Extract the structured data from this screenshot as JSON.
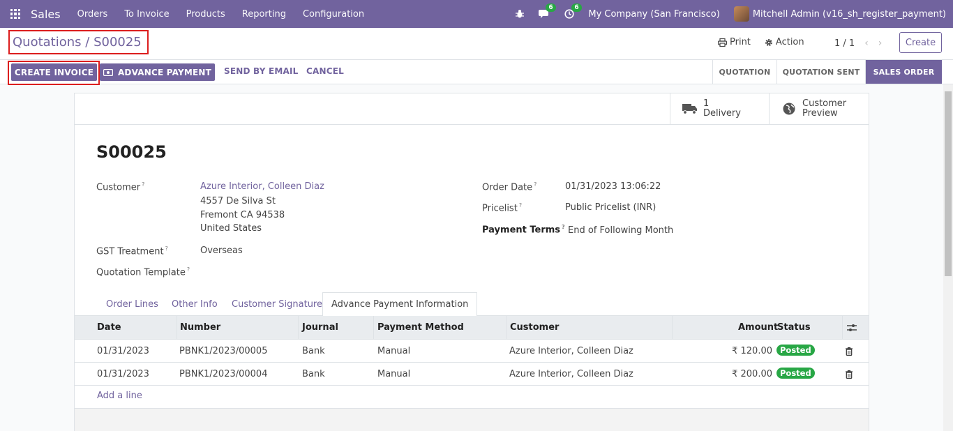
{
  "navbar": {
    "app_name": "Sales",
    "menu": [
      "Orders",
      "To Invoice",
      "Products",
      "Reporting",
      "Configuration"
    ],
    "chat_count": "6",
    "activity_count": "6",
    "company": "My Company (San Francisco)",
    "user": "Mitchell Admin (v16_sh_register_payment)"
  },
  "control_panel": {
    "breadcrumb_parent": "Quotations",
    "breadcrumb_sep": " / ",
    "breadcrumb_current": "S00025",
    "print_label": "Print",
    "action_label": "Action",
    "pager": "1 / 1",
    "create_label": "Create"
  },
  "statusbar": {
    "create_invoice": "CREATE INVOICE",
    "advance_payment": "ADVANCE PAYMENT",
    "send_by_email": "SEND BY EMAIL",
    "cancel": "CANCEL",
    "stages": [
      "QUOTATION",
      "QUOTATION SENT",
      "SALES ORDER"
    ],
    "active_stage": "SALES ORDER"
  },
  "smart_buttons": {
    "delivery_count": "1",
    "delivery_label": "Delivery",
    "preview_line1": "Customer",
    "preview_line2": "Preview"
  },
  "form": {
    "name": "S00025",
    "customer_label": "Customer",
    "customer_name": "Azure Interior, Colleen Diaz",
    "address_line1": "4557 De Silva St",
    "address_line2": "Fremont CA 94538",
    "address_line3": "United States",
    "gst_label": "GST Treatment",
    "gst_value": "Overseas",
    "template_label": "Quotation Template",
    "order_date_label": "Order Date",
    "order_date": "01/31/2023 13:06:22",
    "pricelist_label": "Pricelist",
    "pricelist": "Public Pricelist (INR)",
    "payment_terms_label": "Payment Terms",
    "payment_terms": "End of Following Month",
    "help_mark": "?"
  },
  "tabs": [
    "Order Lines",
    "Other Info",
    "Customer Signature",
    "Advance Payment Information"
  ],
  "payments": {
    "columns": [
      "Date",
      "Number",
      "Journal",
      "Payment Method",
      "Customer",
      "Amount",
      "Status"
    ],
    "rows": [
      {
        "date": "01/31/2023",
        "number": "PBNK1/2023/00005",
        "journal": "Bank",
        "method": "Manual",
        "customer": "Azure Interior, Colleen Diaz",
        "amount": "₹ 120.00",
        "status": "Posted"
      },
      {
        "date": "01/31/2023",
        "number": "PBNK1/2023/00004",
        "journal": "Bank",
        "method": "Manual",
        "customer": "Azure Interior, Colleen Diaz",
        "amount": "₹ 200.00",
        "status": "Posted"
      }
    ],
    "add_line": "Add a line"
  }
}
